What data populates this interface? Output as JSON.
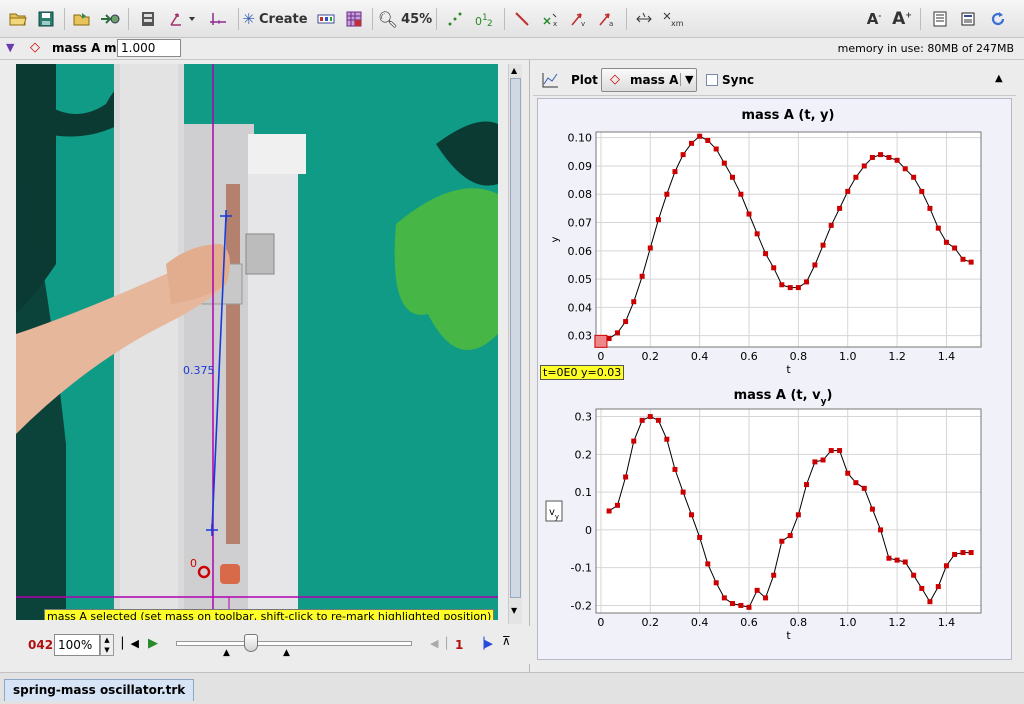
{
  "toolbar": {
    "create_label": "Create",
    "zoom_label": "45%",
    "colors": {
      "accent": "#3a6fd8",
      "track_red": "#cc0000"
    }
  },
  "trackbar": {
    "track_name": "mass A",
    "mass_label": "m",
    "mass_value": "1.000",
    "memory_text": "memory in use: 80MB of 247MB"
  },
  "video": {
    "tape_length": "0.375",
    "origin_label": "0",
    "status_message": "mass A selected (set mass on toolbar, shift-click to re-mark highlighted position)"
  },
  "player": {
    "frame_number": "042",
    "zoom_value": "100%",
    "step_size": "1",
    "slider_position": 0.3
  },
  "plot": {
    "plot_label": "Plot",
    "track_select": "mass A",
    "sync_label": "Sync",
    "readout": "t=0E0  y=0.03"
  },
  "chart_data": [
    {
      "type": "line",
      "title": "mass A (t, y)",
      "xlabel": "t",
      "ylabel": "y",
      "xlim": [
        -0.02,
        1.54
      ],
      "ylim": [
        0.026,
        0.102
      ],
      "xticks": [
        0,
        0.2,
        0.4,
        0.6,
        0.8,
        1.0,
        1.2,
        1.4
      ],
      "xtick_labels": [
        "0",
        "0.2",
        "0.4",
        "0.6",
        "0.8",
        "1.0",
        "1.2",
        "1.4"
      ],
      "yticks": [
        0.03,
        0.04,
        0.05,
        0.06,
        0.07,
        0.08,
        0.09,
        0.1
      ],
      "ytick_labels": [
        "0.03",
        "0.04",
        "0.05",
        "0.06",
        "0.07",
        "0.08",
        "0.09",
        "0.10"
      ],
      "grid": true,
      "color": "#cc0000",
      "x": [
        0.0,
        0.033,
        0.067,
        0.1,
        0.133,
        0.167,
        0.2,
        0.233,
        0.267,
        0.3,
        0.333,
        0.367,
        0.4,
        0.433,
        0.467,
        0.5,
        0.533,
        0.567,
        0.6,
        0.633,
        0.667,
        0.7,
        0.733,
        0.767,
        0.8,
        0.833,
        0.867,
        0.9,
        0.933,
        0.967,
        1.0,
        1.033,
        1.067,
        1.1,
        1.133,
        1.167,
        1.2,
        1.233,
        1.267,
        1.3,
        1.333,
        1.367,
        1.4,
        1.433,
        1.467,
        1.5
      ],
      "y": [
        0.028,
        0.029,
        0.031,
        0.035,
        0.042,
        0.051,
        0.061,
        0.071,
        0.08,
        0.088,
        0.094,
        0.098,
        0.1005,
        0.099,
        0.096,
        0.091,
        0.086,
        0.08,
        0.073,
        0.066,
        0.059,
        0.054,
        0.048,
        0.047,
        0.047,
        0.049,
        0.055,
        0.062,
        0.069,
        0.075,
        0.081,
        0.086,
        0.09,
        0.093,
        0.094,
        0.093,
        0.092,
        0.089,
        0.086,
        0.081,
        0.075,
        0.068,
        0.063,
        0.061,
        0.057,
        0.056
      ]
    },
    {
      "type": "line",
      "title": "mass A (t, v",
      "title_subscript": "y",
      "xlabel": "t",
      "ylabel": "v",
      "ylabel_subscript": "y",
      "xlim": [
        -0.02,
        1.54
      ],
      "ylim": [
        -0.22,
        0.32
      ],
      "xticks": [
        0,
        0.2,
        0.4,
        0.6,
        0.8,
        1.0,
        1.2,
        1.4
      ],
      "xtick_labels": [
        "0",
        "0.2",
        "0.4",
        "0.6",
        "0.8",
        "1.0",
        "1.2",
        "1.4"
      ],
      "yticks": [
        -0.2,
        -0.1,
        0,
        0.1,
        0.2,
        0.3
      ],
      "ytick_labels": [
        "-0.2",
        "-0.1",
        "0",
        "0.1",
        "0.2",
        "0.3"
      ],
      "grid": true,
      "color": "#cc0000",
      "x": [
        0.033,
        0.067,
        0.1,
        0.133,
        0.167,
        0.2,
        0.233,
        0.267,
        0.3,
        0.333,
        0.367,
        0.4,
        0.433,
        0.467,
        0.5,
        0.533,
        0.567,
        0.6,
        0.633,
        0.667,
        0.7,
        0.733,
        0.767,
        0.8,
        0.833,
        0.867,
        0.9,
        0.933,
        0.967,
        1.0,
        1.033,
        1.067,
        1.1,
        1.133,
        1.167,
        1.2,
        1.233,
        1.267,
        1.3,
        1.333,
        1.367,
        1.4,
        1.433,
        1.467,
        1.5
      ],
      "y": [
        0.05,
        0.065,
        0.14,
        0.235,
        0.29,
        0.3,
        0.29,
        0.24,
        0.16,
        0.1,
        0.04,
        -0.02,
        -0.09,
        -0.14,
        -0.18,
        -0.195,
        -0.2,
        -0.205,
        -0.16,
        -0.18,
        -0.12,
        -0.03,
        -0.015,
        0.04,
        0.12,
        0.18,
        0.185,
        0.21,
        0.21,
        0.15,
        0.125,
        0.11,
        0.055,
        0.0,
        -0.075,
        -0.08,
        -0.085,
        -0.12,
        -0.155,
        -0.19,
        -0.15,
        -0.095,
        -0.065,
        -0.06,
        -0.06
      ]
    }
  ]
}
